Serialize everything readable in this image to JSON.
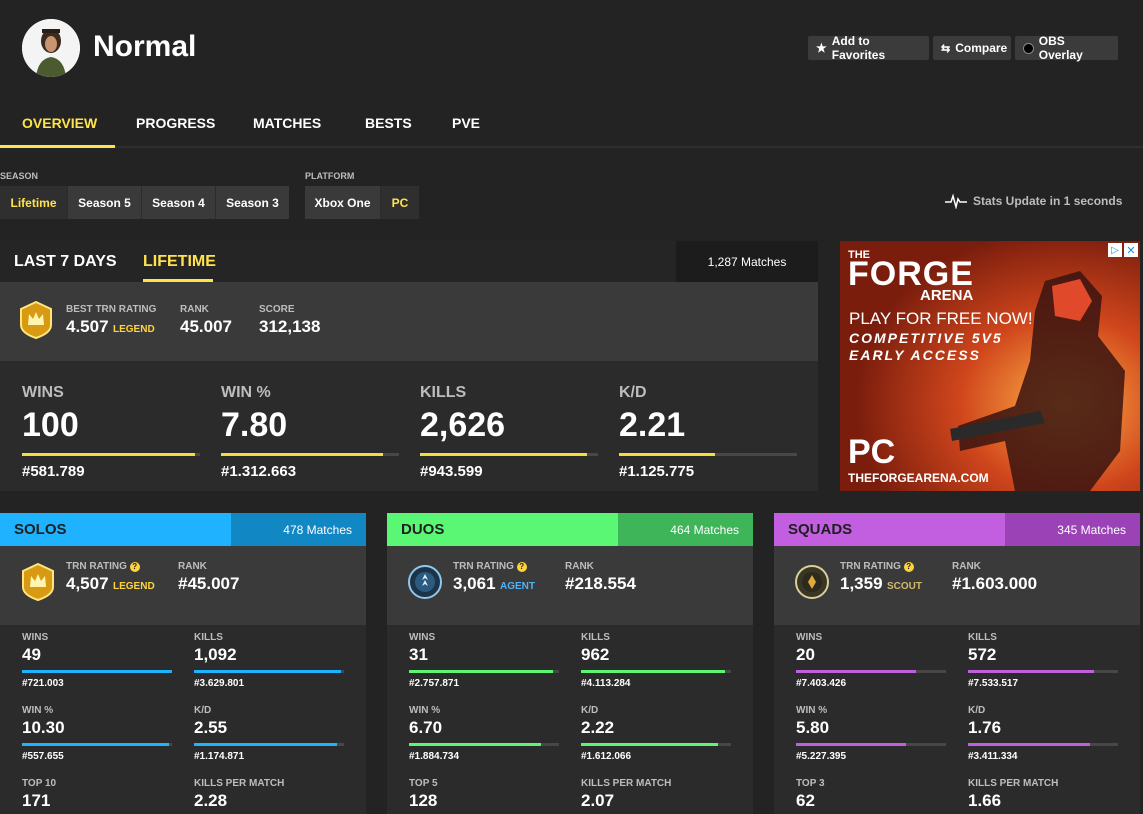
{
  "header": {
    "player_name": "Normal",
    "favorites_label": "Add to Favorites",
    "compare_label": "Compare",
    "obs_label": "OBS Overlay"
  },
  "nav": {
    "tabs": [
      "OVERVIEW",
      "PROGRESS",
      "MATCHES",
      "BESTS",
      "PVE"
    ],
    "active": "OVERVIEW"
  },
  "filters": {
    "season_label": "SEASON",
    "seasons": [
      "Lifetime",
      "Season 5",
      "Season 4",
      "Season 3"
    ],
    "platform_label": "PLATFORM",
    "platforms": [
      "Xbox One",
      "PC"
    ],
    "update_text": "Stats Update in 1 seconds"
  },
  "overview": {
    "tab_7days": "LAST 7 DAYS",
    "tab_lifetime": "LIFETIME",
    "matches": "1,287 Matches",
    "best_trn_label": "BEST TRN RATING",
    "best_trn_value": "4.507",
    "best_trn_tier": "LEGEND",
    "rank_label": "RANK",
    "rank_value": "45.007",
    "score_label": "SCORE",
    "score_value": "312,138",
    "stats": [
      {
        "label": "WINS",
        "value": "100",
        "rank": "#581.789",
        "fill": 0.97
      },
      {
        "label": "WIN %",
        "value": "7.80",
        "rank": "#1.312.663",
        "fill": 0.91
      },
      {
        "label": "KILLS",
        "value": "2,626",
        "rank": "#943.599",
        "fill": 0.94
      },
      {
        "label": "K/D",
        "value": "2.21",
        "rank": "#1.125.775",
        "fill": 0.54
      }
    ]
  },
  "ad": {
    "brand_top": "THE",
    "brand_main": "FORGE",
    "brand_sub": "ARENA",
    "line1": "PLAY FOR FREE NOW!",
    "line2": "COMPETITIVE 5V5",
    "line3": "EARLY ACCESS",
    "platform": "PC",
    "url": "THEFORGEARENA.COM"
  },
  "modes": [
    {
      "name": "SOLOS",
      "matches": "478 Matches",
      "color": "#1fb2ff",
      "dark": "#1187c4",
      "trn_label": "TRN RATING",
      "trn_value": "4,507",
      "tier": "LEGEND",
      "tier_color": "#ffd43b",
      "rank_label": "RANK",
      "rank_value": "#45.007",
      "stats": [
        {
          "label": "WINS",
          "value": "49",
          "rank": "#721.003",
          "fill": 1.0
        },
        {
          "label": "KILLS",
          "value": "1,092",
          "rank": "#3.629.801",
          "fill": 0.98
        },
        {
          "label": "WIN %",
          "value": "10.30",
          "rank": "#557.655",
          "fill": 0.98
        },
        {
          "label": "K/D",
          "value": "2.55",
          "rank": "#1.174.871",
          "fill": 0.95
        },
        {
          "label": "TOP 10",
          "value": "171"
        },
        {
          "label": "KILLS PER MATCH",
          "value": "2.28"
        }
      ]
    },
    {
      "name": "DUOS",
      "matches": "464 Matches",
      "color": "#5af775",
      "dark": "#3fb55a",
      "trn_label": "TRN RATING",
      "trn_value": "3,061",
      "tier": "AGENT",
      "tier_color": "#4fb4f7",
      "rank_label": "RANK",
      "rank_value": "#218.554",
      "stats": [
        {
          "label": "WINS",
          "value": "31",
          "rank": "#2.757.871",
          "fill": 0.96
        },
        {
          "label": "KILLS",
          "value": "962",
          "rank": "#4.113.284",
          "fill": 0.96
        },
        {
          "label": "WIN %",
          "value": "6.70",
          "rank": "#1.884.734",
          "fill": 0.88
        },
        {
          "label": "K/D",
          "value": "2.22",
          "rank": "#1.612.066",
          "fill": 0.91
        },
        {
          "label": "TOP 5",
          "value": "128"
        },
        {
          "label": "KILLS PER MATCH",
          "value": "2.07"
        }
      ]
    },
    {
      "name": "SQUADS",
      "matches": "345 Matches",
      "color": "#c25ee0",
      "dark": "#9b43b6",
      "trn_label": "TRN RATING",
      "trn_value": "1,359",
      "tier": "SCOUT",
      "tier_color": "#d2b96a",
      "rank_label": "RANK",
      "rank_value": "#1.603.000",
      "stats": [
        {
          "label": "WINS",
          "value": "20",
          "rank": "#7.403.426",
          "fill": 0.8
        },
        {
          "label": "KILLS",
          "value": "572",
          "rank": "#7.533.517",
          "fill": 0.84
        },
        {
          "label": "WIN %",
          "value": "5.80",
          "rank": "#5.227.395",
          "fill": 0.73
        },
        {
          "label": "K/D",
          "value": "1.76",
          "rank": "#3.411.334",
          "fill": 0.81
        },
        {
          "label": "TOP 3",
          "value": "62"
        },
        {
          "label": "KILLS PER MATCH",
          "value": "1.66"
        }
      ]
    }
  ],
  "colors": {
    "accent": "#ffe34d",
    "bar_yellow": "#f2dd44"
  }
}
